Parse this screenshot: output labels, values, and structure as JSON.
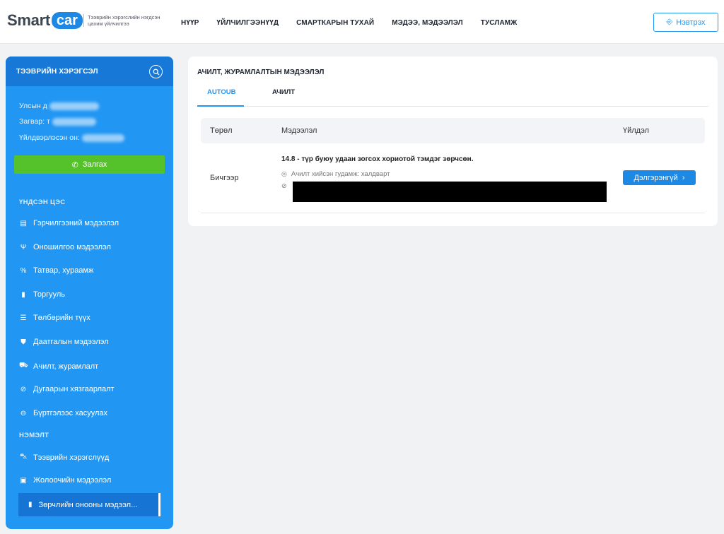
{
  "header": {
    "logo_smart": "Smart",
    "logo_car": "car",
    "tagline": "Тээврийн хэрэгслийн нэгдсэн цахим үйлчилгээ",
    "nav": [
      "НҮҮР",
      "ҮЙЛЧИЛГЭЭНҮҮД",
      "СМАРТКАРЫН ТУХАЙ",
      "МЭДЭЭ, МЭДЭЭЛЭЛ",
      "ТУСЛАМЖ"
    ],
    "login_label": "Нэвтрэх"
  },
  "sidebar": {
    "title": "ТЭЭВРИЙН ХЭРЭГСЭЛ",
    "plate_label": "Улсын д",
    "model_label": "Загвар: т",
    "year_label": "Үйлдвэрлэсэн он:",
    "call_label": "Залгах",
    "main_menu_label": "ҮНДСЭН ЦЭС",
    "main_items": [
      {
        "label": "Гэрчилгээний мэдээлэл",
        "icon": "document-icon"
      },
      {
        "label": "Оношилгоо мэдээлэл",
        "icon": "stethoscope-icon"
      },
      {
        "label": "Татвар, хураамж",
        "icon": "percent-icon"
      },
      {
        "label": "Торгууль",
        "icon": "receipt-icon"
      },
      {
        "label": "Төлбөрийн түүх",
        "icon": "list-icon"
      },
      {
        "label": "Даатгалын мэдээлэл",
        "icon": "shield-icon"
      },
      {
        "label": "Ачилт, журамлалт",
        "icon": "tow-truck-icon"
      },
      {
        "label": "Дугаарын хязгаарлалт",
        "icon": "ban-icon"
      },
      {
        "label": "Бүртгэлээс хасуулах",
        "icon": "minus-circle-icon"
      }
    ],
    "extra_label": "НЭМЭЛТ",
    "extra_items": [
      {
        "label": "Тээврийн хэрэгслүүд",
        "icon": "car-icon"
      },
      {
        "label": "Жолоочийн мэдээлэл",
        "icon": "id-card-icon"
      }
    ],
    "active_item": "Зөрчлийн онооны мэдээл..."
  },
  "main": {
    "title": "АЧИЛТ, ЖУРАМЛАЛТЫН МЭДЭЭЛЭЛ",
    "tabs": [
      "AUTOUB",
      "АЧИЛТ"
    ],
    "active_tab": "AUTOUB",
    "columns": [
      "Төрөл",
      "Мэдээлэл",
      "Үйлдэл"
    ],
    "rows": [
      {
        "type": "Бичгээр",
        "title": "14.8 - түр буюу удаан зогсох хориотой тэмдэг зөрчсөн.",
        "location": "Ачилт хийсэн гудамж: халдварт",
        "action": "Дэлгэрэнгүй"
      }
    ]
  },
  "colors": {
    "primary": "#2196f3",
    "sidebar_dark": "#1778d8",
    "call_green": "#56c22b",
    "background": "#f1f2f4"
  }
}
